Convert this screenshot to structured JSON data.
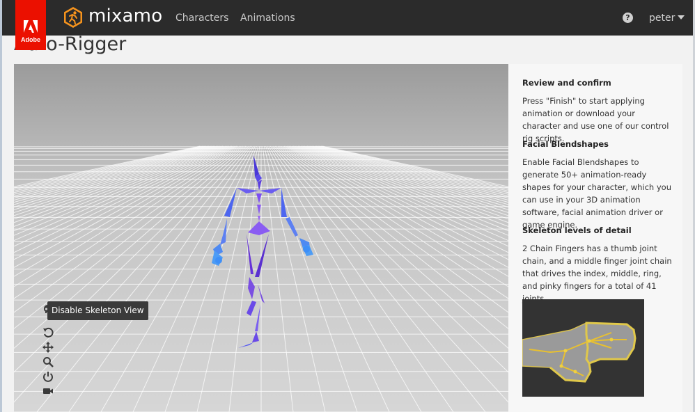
{
  "app": {
    "adobe_label": "Adobe",
    "brand": "mixamo",
    "brand_color": "#f7941d",
    "adobe_color": "#eb1000"
  },
  "nav": {
    "items": [
      {
        "label": "Characters"
      },
      {
        "label": "Animations"
      }
    ],
    "help_icon": "help-circle-icon",
    "user": "peter"
  },
  "page": {
    "title": "Auto-Rigger"
  },
  "viewport": {
    "tooltip": "Disable Skeleton View",
    "tools": [
      "skull-icon",
      "rotate-icon",
      "pan-icon",
      "zoom-icon",
      "power-icon",
      "camera-icon"
    ]
  },
  "panel": {
    "sections": [
      {
        "heading": "Review and confirm",
        "body": "Press \"Finish\" to start applying animation or download your character and use one of our control rig scripts."
      },
      {
        "heading": "Facial Blendshapes",
        "body": "Enable Facial Blendshapes to generate 50+ animation-ready shapes for your character, which you can use in your 3D animation software, facial animation driver or game engine."
      },
      {
        "heading": "Skeleton levels of detail",
        "body": "2 Chain Fingers has a thumb joint chain, and a middle finger joint chain that drives the index, middle, ring, and pinky fingers for a total of 41 joints."
      }
    ],
    "image": "hand-skeleton-illustration"
  }
}
